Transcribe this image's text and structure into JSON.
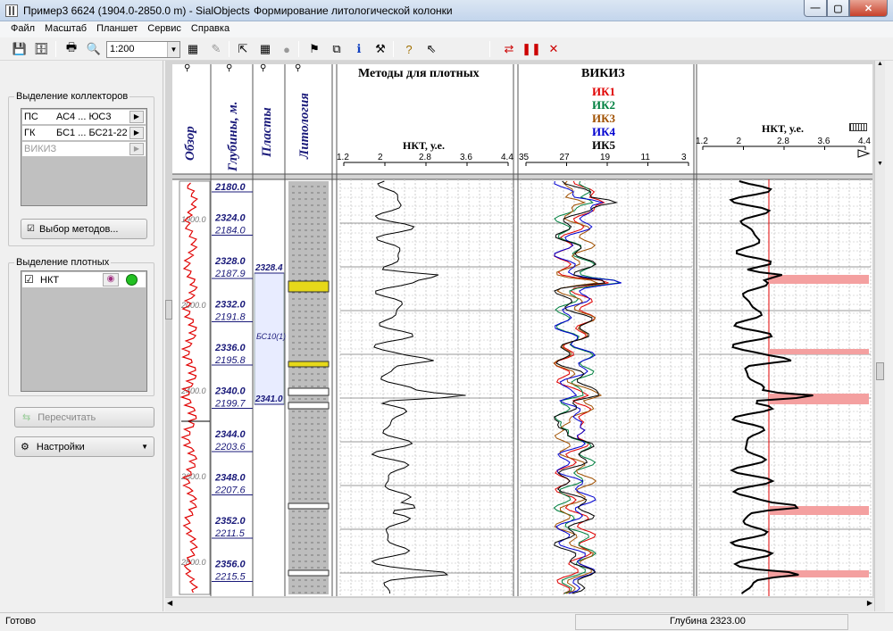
{
  "window": {
    "title": "Пример3  6624  (1904.0-2850.0 m) - SialObjects",
    "subtitle": "Формирование литологической колонки"
  },
  "menu": [
    "Файл",
    "Масштаб",
    "Планшет",
    "Сервис",
    "Справка"
  ],
  "toolbar": {
    "scale": "1:200"
  },
  "collectors": {
    "group_title": "Выделение коллекторов",
    "rows": [
      {
        "name": "ПС",
        "value": "АС4 ... ЮС3",
        "enabled": true
      },
      {
        "name": "ГК",
        "value": "БС1 ... БС21-22",
        "enabled": true
      },
      {
        "name": "ВИКИЗ",
        "value": "",
        "enabled": false
      }
    ],
    "methods_button": "Выбор методов..."
  },
  "dense": {
    "group_title": "Выделение плотных",
    "rows": [
      {
        "name": "НКТ",
        "checked": true
      }
    ]
  },
  "buttons": {
    "recalc": "Пересчитать",
    "settings": "Настройки"
  },
  "tracks": {
    "overview": "Обзор",
    "depths": "Глубины, м.",
    "layers": "Пласты",
    "lithology": "Литология",
    "dense_title": "Методы для плотных",
    "nkt_label": "НКТ, у.е.",
    "nkt_ticks": [
      "1.2",
      "2",
      "2.8",
      "3.6",
      "4.4"
    ],
    "vikiz_title": "ВИКИЗ",
    "vikiz_curves": [
      {
        "name": "ИК1",
        "color": "#e00000"
      },
      {
        "name": "ИК2",
        "color": "#008040"
      },
      {
        "name": "ИК3",
        "color": "#a05000"
      },
      {
        "name": "ИК4",
        "color": "#0000d0"
      },
      {
        "name": "ИК5",
        "color": "#000000"
      }
    ],
    "vikiz_ticks": [
      "35",
      "27",
      "19",
      "11",
      "3"
    ],
    "right_nkt_label": "НКТ, у.е.",
    "right_ticks": [
      "1.2",
      "2",
      "2.8",
      "3.6",
      "4.4"
    ]
  },
  "depths": [
    {
      "md": "2180.0",
      "abs": null
    },
    {
      "md": "2324.0",
      "abs": "2184.0"
    },
    {
      "md": "2328.0",
      "abs": "2187.9"
    },
    {
      "md": "2332.0",
      "abs": "2191.8"
    },
    {
      "md": "2336.0",
      "abs": "2195.8"
    },
    {
      "md": "2340.0",
      "abs": "2199.7"
    },
    {
      "md": "2344.0",
      "abs": "2203.6"
    },
    {
      "md": "2348.0",
      "abs": "2207.6"
    },
    {
      "md": "2352.0",
      "abs": "2211.5"
    },
    {
      "md": "2356.0",
      "abs": "2215.5"
    }
  ],
  "overview_ticks": [
    "1900.0",
    "2000.0",
    "2400.0",
    "2600.0",
    "2800.0"
  ],
  "layer": {
    "top": "2328.4",
    "name": "БС10(1)",
    "bottom": "2341.0"
  },
  "status": {
    "ready": "Готово",
    "depth": "Глубина  2323.00"
  }
}
